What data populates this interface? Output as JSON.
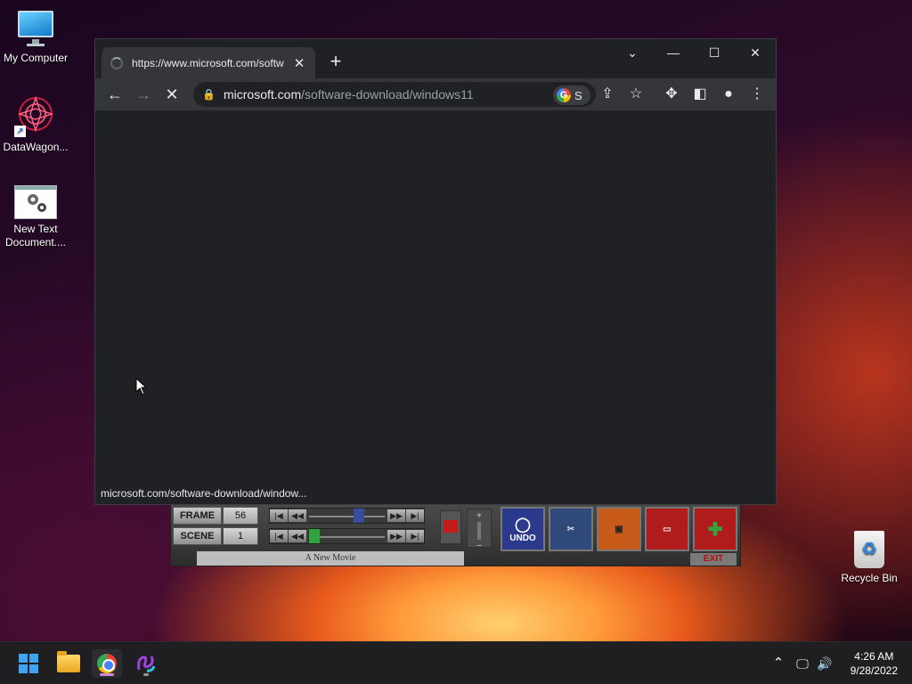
{
  "desktop": {
    "icons": [
      {
        "label": "My Computer"
      },
      {
        "label": "DataWagon..."
      },
      {
        "label": "New Text Document...."
      }
    ],
    "recycle_bin": {
      "label": "Recycle Bin"
    }
  },
  "browser": {
    "tab": {
      "title": "https://www.microsoft.com/softw"
    },
    "omnibox": {
      "host": "microsoft.com",
      "path": "/software-download/windows11"
    },
    "google_pill": {
      "letter": "S"
    },
    "status_url": "microsoft.com/software-download/window..."
  },
  "movie_maker": {
    "frame": {
      "label": "FRAME",
      "value": "56"
    },
    "scene": {
      "label": "SCENE",
      "value": "1"
    },
    "tools": [
      {
        "label": "UNDO",
        "color": "#2b3a8c"
      },
      {
        "label": "",
        "color": "#2f4a7a"
      },
      {
        "label": "",
        "color": "#c85a1a"
      },
      {
        "label": "",
        "color": "#b01c1c"
      },
      {
        "label": "",
        "color": "#b01c1c"
      }
    ],
    "movie_title": "A New Movie",
    "exit_label": "EXIT"
  },
  "taskbar": {
    "clock_time": "4:26 AM",
    "clock_date": "9/28/2022"
  },
  "colors": {
    "accent": "#3da5f4",
    "browser_bg": "#202124"
  }
}
